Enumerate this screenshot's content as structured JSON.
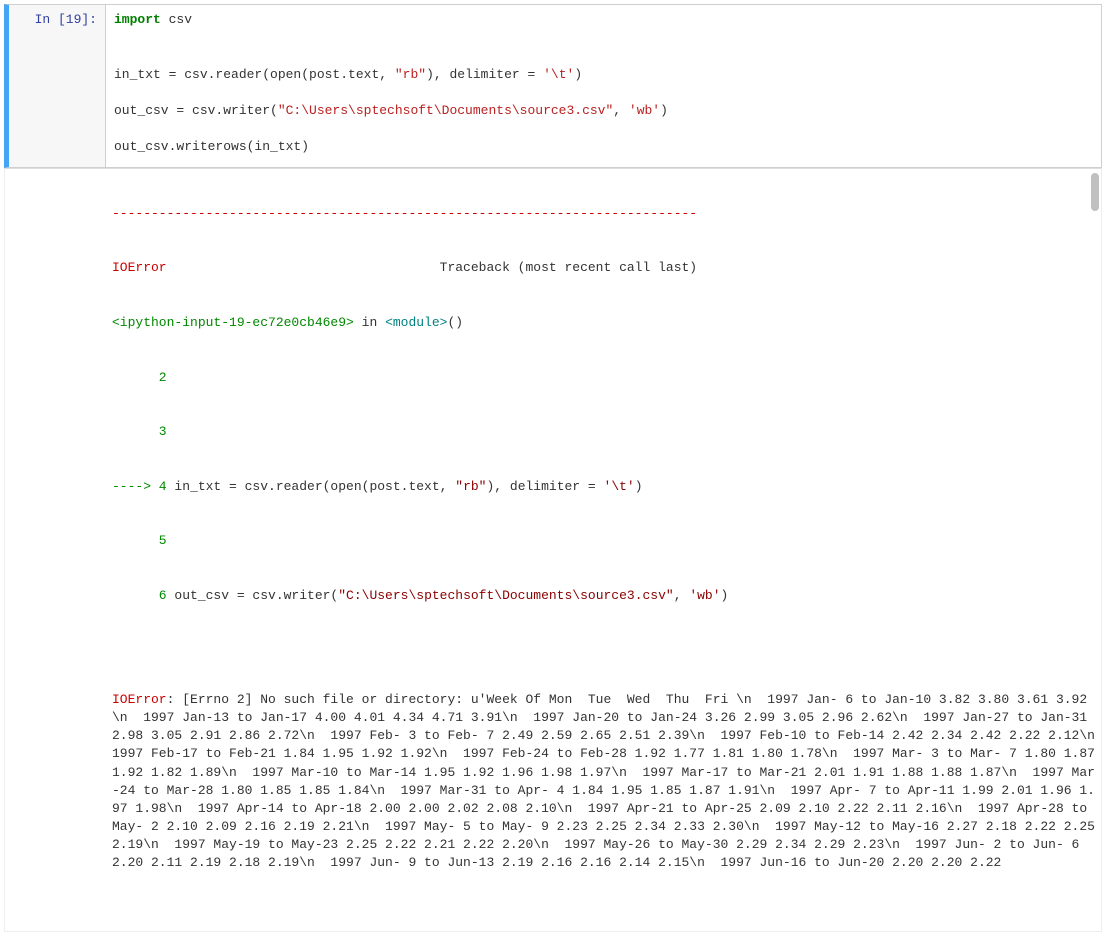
{
  "input": {
    "prompt": "In [19]:",
    "code": {
      "l1_import": "import",
      "l1_mod": " csv",
      "blank1": "",
      "blank2": "",
      "l4_a": "in_txt = csv.reader(open(post.text, ",
      "l4_str1": "\"rb\"",
      "l4_b": "), delimiter = ",
      "l4_str2": "'\\t'",
      "l4_c": ")",
      "blank3": "",
      "l6_a": "out_csv = csv.writer(",
      "l6_str1": "\"C:\\Users\\sptechsoft\\Documents\\source3.csv\"",
      "l6_b": ", ",
      "l6_str2": "'wb'",
      "l6_c": ")",
      "blank4": "",
      "l8": "out_csv.writerows(in_txt)"
    }
  },
  "output": {
    "dash": "---------------------------------------------------------------------------",
    "err_name": "IOError",
    "tb_header_tail": "                                   Traceback (most recent call last)",
    "frame_loc_a": "<ipython-input-19-ec72e0cb46e9>",
    "frame_loc_b": " in ",
    "frame_module": "<module>",
    "frame_loc_c": "()",
    "line2_num": "      2",
    "line2_txt": " ",
    "line3_num": "      3",
    "line3_txt": " ",
    "arrow": "----> 4",
    "line4_a": " in_txt = csv.reader(open(post.text, ",
    "line4_str1": "\"rb\"",
    "line4_b": "), delimiter = ",
    "line4_str2": "'\\t'",
    "line4_c": ")",
    "line5_num": "      5",
    "line5_txt": " ",
    "line6_num": "      6",
    "line6_a": " out_csv = csv.writer(",
    "line6_str1": "\"C:\\Users\\sptechsoft\\Documents\\source3.csv\"",
    "line6_b": ", ",
    "line6_str2": "'wb'",
    "line6_c": ")",
    "final_err": "IOError",
    "final_msg": ": [Errno 2] No such file or directory: u'Week Of Mon  Tue  Wed  Thu  Fri \\n  1997 Jan- 6 to Jan-10 3.82 3.80 3.61 3.92\\n  1997 Jan-13 to Jan-17 4.00 4.01 4.34 4.71 3.91\\n  1997 Jan-20 to Jan-24 3.26 2.99 3.05 2.96 2.62\\n  1997 Jan-27 to Jan-31 2.98 3.05 2.91 2.86 2.72\\n  1997 Feb- 3 to Feb- 7 2.49 2.59 2.65 2.51 2.39\\n  1997 Feb-10 to Feb-14 2.42 2.34 2.42 2.22 2.12\\n  1997 Feb-17 to Feb-21 1.84 1.95 1.92 1.92\\n  1997 Feb-24 to Feb-28 1.92 1.77 1.81 1.80 1.78\\n  1997 Mar- 3 to Mar- 7 1.80 1.87 1.92 1.82 1.89\\n  1997 Mar-10 to Mar-14 1.95 1.92 1.96 1.98 1.97\\n  1997 Mar-17 to Mar-21 2.01 1.91 1.88 1.88 1.87\\n  1997 Mar-24 to Mar-28 1.80 1.85 1.85 1.84\\n  1997 Mar-31 to Apr- 4 1.84 1.95 1.85 1.87 1.91\\n  1997 Apr- 7 to Apr-11 1.99 2.01 1.96 1.97 1.98\\n  1997 Apr-14 to Apr-18 2.00 2.00 2.02 2.08 2.10\\n  1997 Apr-21 to Apr-25 2.09 2.10 2.22 2.11 2.16\\n  1997 Apr-28 to May- 2 2.10 2.09 2.16 2.19 2.21\\n  1997 May- 5 to May- 9 2.23 2.25 2.34 2.33 2.30\\n  1997 May-12 to May-16 2.27 2.18 2.22 2.25 2.19\\n  1997 May-19 to May-23 2.25 2.22 2.21 2.22 2.20\\n  1997 May-26 to May-30 2.29 2.34 2.29 2.23\\n  1997 Jun- 2 to Jun- 6 2.20 2.11 2.19 2.18 2.19\\n  1997 Jun- 9 to Jun-13 2.19 2.16 2.16 2.14 2.15\\n  1997 Jun-16 to Jun-20 2.20 2.20 2.22"
  }
}
